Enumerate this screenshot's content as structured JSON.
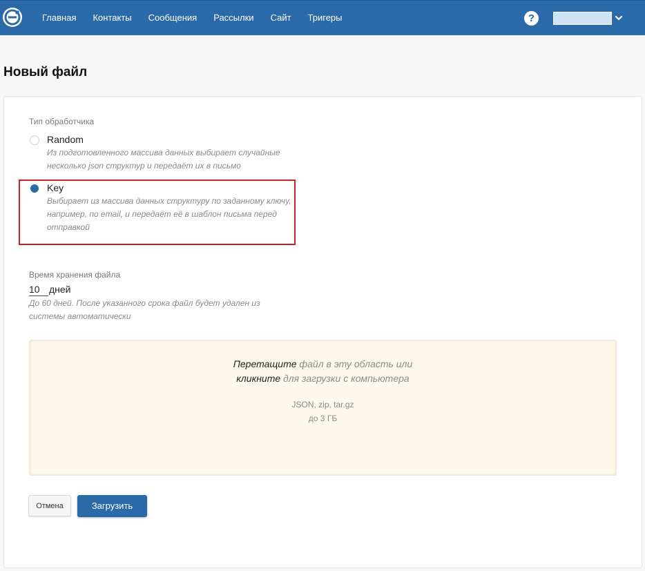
{
  "nav": {
    "items": [
      {
        "label": "Главная"
      },
      {
        "label": "Контакты"
      },
      {
        "label": "Сообщения"
      },
      {
        "label": "Рассылки"
      },
      {
        "label": "Сайт"
      },
      {
        "label": "Тригеры"
      }
    ],
    "help_glyph": "?"
  },
  "icons": {
    "logo": "brand-logo-icon",
    "help": "question-circle-icon",
    "account": "chevron-down-icon"
  },
  "colors": {
    "brand": "#2a6aa8",
    "highlight": "#c8202a",
    "dropzone_bg": "#fdf9ec"
  },
  "page": {
    "title": "Новый файл"
  },
  "handler": {
    "label": "Тип обработчика",
    "options": [
      {
        "title": "Random",
        "desc": "Из подготовленного массива данных выбирает случайные несколько json структур и передаёт их в письмо",
        "selected": false
      },
      {
        "title": "Key",
        "desc": "Выбирает из массива данных структуру по заданному ключу, например, по email, и передаёт её в шаблон письма перед отправкой",
        "selected": true
      }
    ]
  },
  "storage": {
    "label": "Время хранения файла",
    "value": "10",
    "unit": "дней",
    "hint": "До 60 дней. После указанного срока файл будет удален из системы автоматически"
  },
  "dropzone": {
    "line1_em": "Перетащите",
    "line1_rest": " файл в эту область или",
    "line2_em": "кликните",
    "line2_rest": " для загрузки с компьютера",
    "formats": "JSON, zip, tar.gz",
    "limit": "до 3 ГБ"
  },
  "actions": {
    "cancel": "Отмена",
    "upload": "Загрузить"
  }
}
